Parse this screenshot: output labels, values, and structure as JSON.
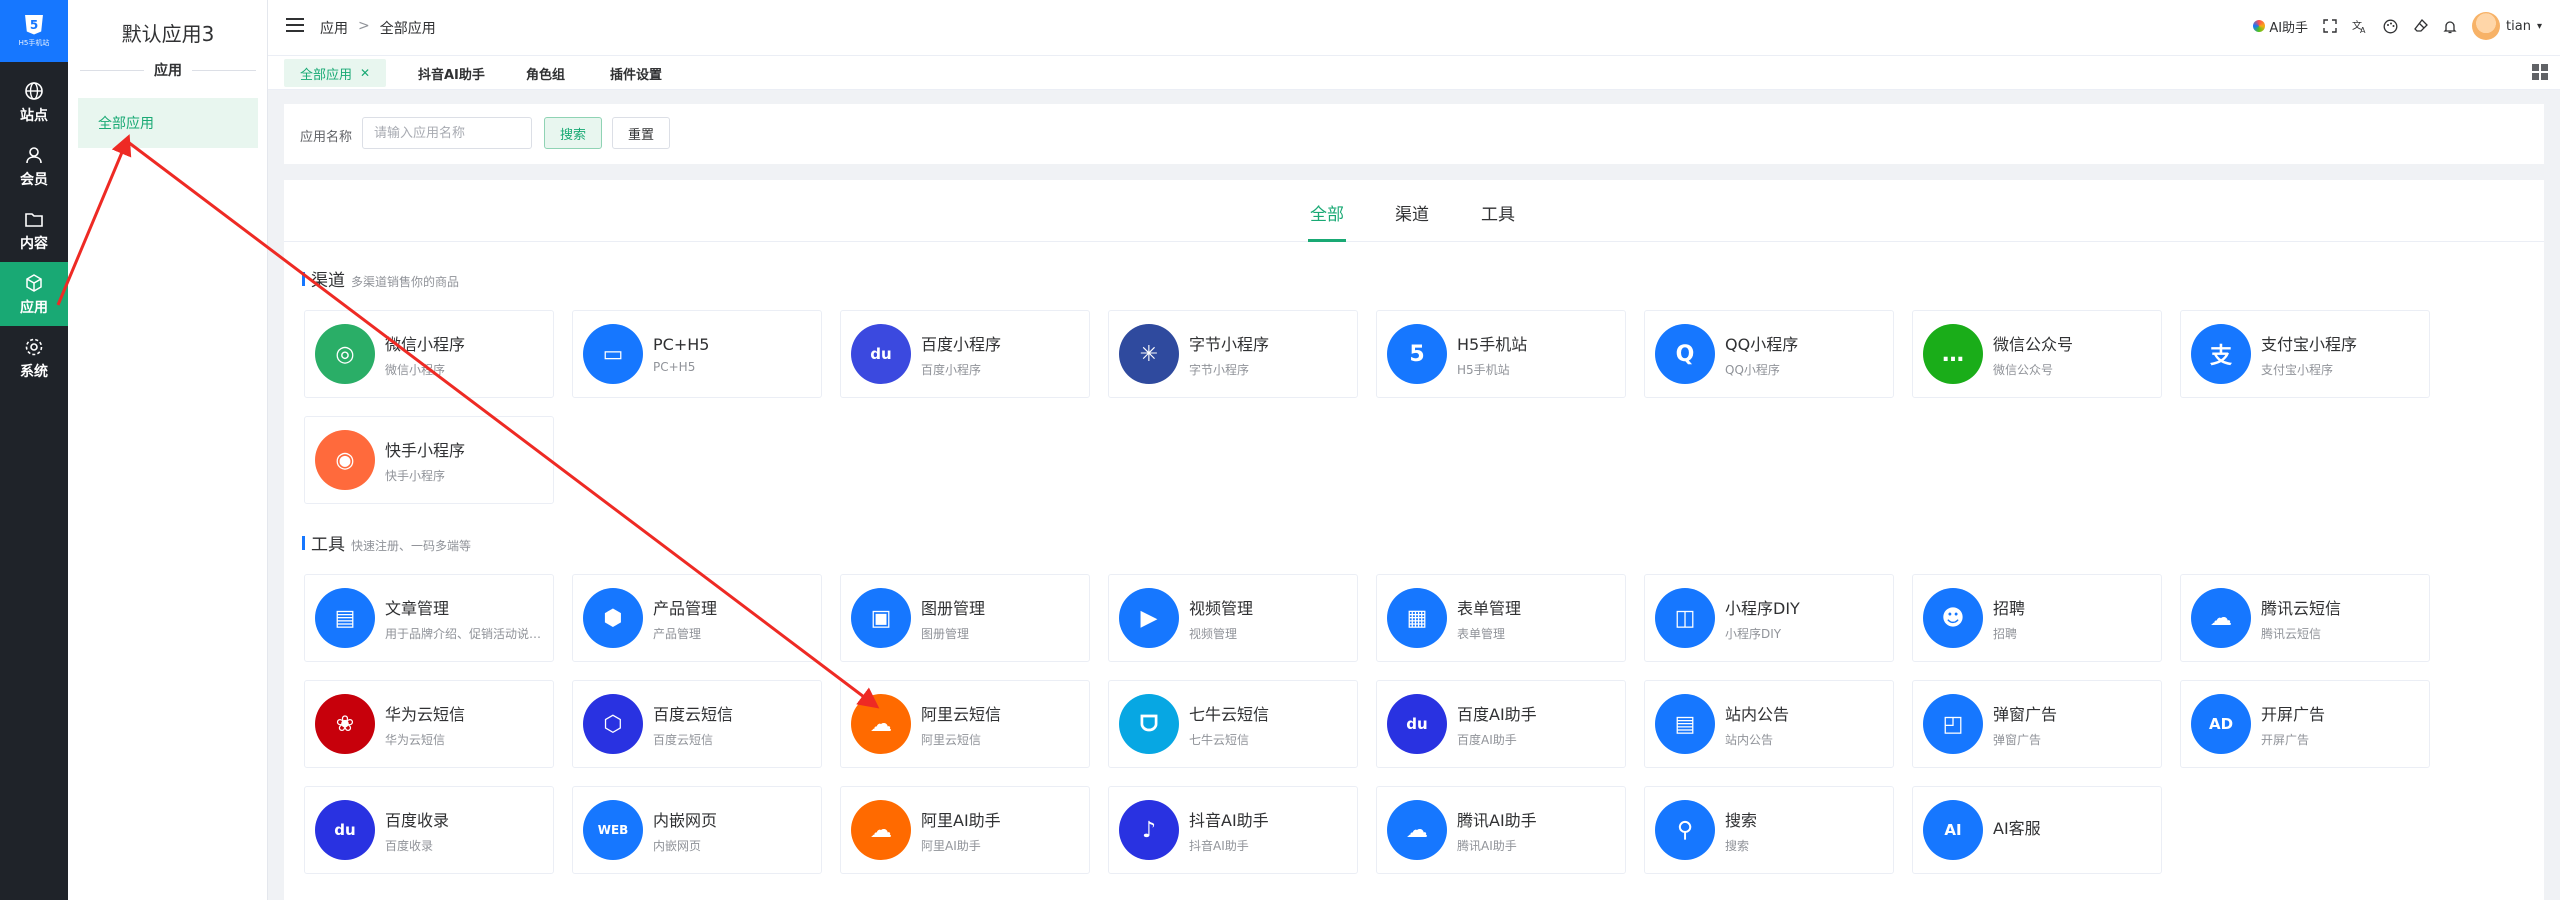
{
  "rail": {
    "logo_caption": "H5手机站",
    "items": [
      {
        "label": "站点",
        "icon": "globe-icon"
      },
      {
        "label": "会员",
        "icon": "user-icon"
      },
      {
        "label": "内容",
        "icon": "folder-icon"
      },
      {
        "label": "应用",
        "icon": "cube-icon",
        "active": true
      },
      {
        "label": "系统",
        "icon": "gear-icon"
      }
    ]
  },
  "sidebar": {
    "title": "默认应用3",
    "subtitle": "应用",
    "menu": [
      {
        "label": "全部应用",
        "active": true
      }
    ]
  },
  "header": {
    "breadcrumb": [
      "应用",
      ">",
      "全部应用"
    ],
    "ai_label": "AI助手",
    "username": "tian"
  },
  "tabs": [
    {
      "label": "全部应用",
      "active": true,
      "closable": true
    },
    {
      "label": "抖音AI助手"
    },
    {
      "label": "角色组"
    },
    {
      "label": "插件设置"
    }
  ],
  "search": {
    "label": "应用名称",
    "placeholder": "请输入应用名称",
    "search_btn": "搜索",
    "reset_btn": "重置"
  },
  "categories": [
    {
      "label": "全部",
      "active": true
    },
    {
      "label": "渠道"
    },
    {
      "label": "工具"
    }
  ],
  "sections": [
    {
      "title": "渠道",
      "desc": "多渠道销售你的商品",
      "apps": [
        {
          "name": "微信小程序",
          "desc": "微信小程序",
          "icon": "wechat-miniprogram-icon",
          "color": "#2aae67",
          "glyph": "◎"
        },
        {
          "name": "PC+H5",
          "desc": "PC+H5",
          "icon": "monitor-icon",
          "color": "#1677ff",
          "glyph": "▭"
        },
        {
          "name": "百度小程序",
          "desc": "百度小程序",
          "icon": "baidu-paw-icon",
          "color": "#3b49df",
          "glyph": "du"
        },
        {
          "name": "字节小程序",
          "desc": "字节小程序",
          "icon": "bytedance-icon",
          "color": "#2f4a9e",
          "glyph": "✳"
        },
        {
          "name": "H5手机站",
          "desc": "H5手机站",
          "icon": "html5-icon",
          "color": "#1677ff",
          "glyph": "5"
        },
        {
          "name": "QQ小程序",
          "desc": "QQ小程序",
          "icon": "qq-icon",
          "color": "#1677ff",
          "glyph": "Q"
        },
        {
          "name": "微信公众号",
          "desc": "微信公众号",
          "icon": "wechat-official-icon",
          "color": "#1aad19",
          "glyph": "…"
        },
        {
          "name": "支付宝小程序",
          "desc": "支付宝小程序",
          "icon": "alipay-icon",
          "color": "#1677ff",
          "glyph": "支"
        },
        {
          "name": "快手小程序",
          "desc": "快手小程序",
          "icon": "kuaishou-icon",
          "color": "#ff6a3c",
          "glyph": "◉"
        }
      ]
    },
    {
      "title": "工具",
      "desc": "快速注册、一码多端等",
      "apps": [
        {
          "name": "文章管理",
          "desc": "用于品牌介绍、促销活动说明、技巧",
          "icon": "article-icon",
          "color": "#1677ff",
          "glyph": "▤"
        },
        {
          "name": "产品管理",
          "desc": "产品管理",
          "icon": "product-icon",
          "color": "#1677ff",
          "glyph": "⬢"
        },
        {
          "name": "图册管理",
          "desc": "图册管理",
          "icon": "album-icon",
          "color": "#1677ff",
          "glyph": "▣"
        },
        {
          "name": "视频管理",
          "desc": "视频管理",
          "icon": "video-icon",
          "color": "#1677ff",
          "glyph": "▶"
        },
        {
          "name": "表单管理",
          "desc": "表单管理",
          "icon": "form-icon",
          "color": "#1677ff",
          "glyph": "▦"
        },
        {
          "name": "小程序DIY",
          "desc": "小程序DIY",
          "icon": "diy-icon",
          "color": "#1677ff",
          "glyph": "◫"
        },
        {
          "name": "招聘",
          "desc": "招聘",
          "icon": "recruit-icon",
          "color": "#1677ff",
          "glyph": "☻"
        },
        {
          "name": "腾讯云短信",
          "desc": "腾讯云短信",
          "icon": "tencent-cloud-icon",
          "color": "#1677ff",
          "glyph": "☁"
        },
        {
          "name": "华为云短信",
          "desc": "华为云短信",
          "icon": "huawei-icon",
          "color": "#c7000b",
          "glyph": "❀"
        },
        {
          "name": "百度云短信",
          "desc": "百度云短信",
          "icon": "baidu-cloud-icon",
          "color": "#2932e1",
          "glyph": "⬡"
        },
        {
          "name": "阿里云短信",
          "desc": "阿里云短信",
          "icon": "aliyun-icon",
          "color": "#ff6a00",
          "glyph": "☁"
        },
        {
          "name": "七牛云短信",
          "desc": "七牛云短信",
          "icon": "qiniu-icon",
          "color": "#07a7e3",
          "glyph": "ᗜ"
        },
        {
          "name": "百度AI助手",
          "desc": "百度AI助手",
          "icon": "baidu-ai-icon",
          "color": "#2932e1",
          "glyph": "du"
        },
        {
          "name": "站内公告",
          "desc": "站内公告",
          "icon": "notice-icon",
          "color": "#1677ff",
          "glyph": "▤"
        },
        {
          "name": "弹窗广告",
          "desc": "弹窗广告",
          "icon": "popup-ad-icon",
          "color": "#1677ff",
          "glyph": "◰"
        },
        {
          "name": "开屏广告",
          "desc": "开屏广告",
          "icon": "splash-ad-icon",
          "color": "#1677ff",
          "glyph": "AD"
        },
        {
          "name": "百度收录",
          "desc": "百度收录",
          "icon": "baidu-index-icon",
          "color": "#2932e1",
          "glyph": "du"
        },
        {
          "name": "内嵌网页",
          "desc": "内嵌网页",
          "icon": "web-icon",
          "color": "#1677ff",
          "glyph": "WEB"
        },
        {
          "name": "阿里AI助手",
          "desc": "阿里AI助手",
          "icon": "ali-ai-icon",
          "color": "#ff6a00",
          "glyph": "☁"
        },
        {
          "name": "抖音AI助手",
          "desc": "抖音AI助手",
          "icon": "douyin-icon",
          "color": "#2932e1",
          "glyph": "♪"
        },
        {
          "name": "腾讯AI助手",
          "desc": "腾讯AI助手",
          "icon": "tencent-ai-icon",
          "color": "#1677ff",
          "glyph": "☁"
        },
        {
          "name": "搜索",
          "desc": "搜索",
          "icon": "search-icon",
          "color": "#1677ff",
          "glyph": "⚲"
        },
        {
          "name": "AI客服",
          "desc": "",
          "icon": "ai-service-icon",
          "color": "#1677ff",
          "glyph": "AI"
        }
      ]
    }
  ],
  "annotation_color": "#ee2a24"
}
